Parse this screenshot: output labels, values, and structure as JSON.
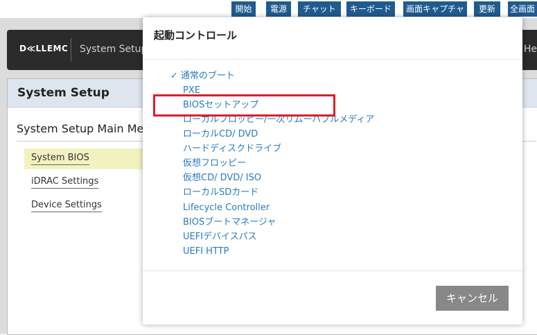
{
  "toolbar": {
    "buttons": [
      "開始",
      "電源",
      "チャット",
      "キーボード",
      "画面キャプチャ",
      "更新",
      "全画面"
    ]
  },
  "header": {
    "logo": "D≪LLEMC",
    "title": "System Setup",
    "right_text": "He"
  },
  "panel": {
    "title": "System Setup",
    "main_menu_title": "System Setup Main Menu",
    "items": [
      {
        "label": "System BIOS",
        "selected": true
      },
      {
        "label": "iDRAC Settings",
        "selected": false
      },
      {
        "label": "Device Settings",
        "selected": false
      }
    ]
  },
  "modal": {
    "title": "起動コントロール",
    "check_glyph": "✓",
    "options": [
      {
        "label": "通常のブート",
        "checked": true
      },
      {
        "label": "PXE",
        "checked": false
      },
      {
        "label": "BIOSセットアップ",
        "checked": false
      },
      {
        "label": "ローカルフロッピー/一次リムーバブルメディア",
        "checked": false
      },
      {
        "label": "ローカルCD/ DVD",
        "checked": false
      },
      {
        "label": "ハードディスクドライブ",
        "checked": false
      },
      {
        "label": "仮想フロッピー",
        "checked": false
      },
      {
        "label": "仮想CD/ DVD/ ISO",
        "checked": false
      },
      {
        "label": "ローカルSDカード",
        "checked": false
      },
      {
        "label": "Lifecycle Controller",
        "checked": false
      },
      {
        "label": "BIOSブートマネージャ",
        "checked": false
      },
      {
        "label": "UEFIデバイスパス",
        "checked": false
      },
      {
        "label": "UEFI HTTP",
        "checked": false
      }
    ],
    "cancel_label": "キャンセル"
  },
  "colors": {
    "toolbar_button": "#1f5b8e",
    "link": "#2a7bbd",
    "highlight": "#d9202b",
    "cancel_button": "#888888"
  }
}
